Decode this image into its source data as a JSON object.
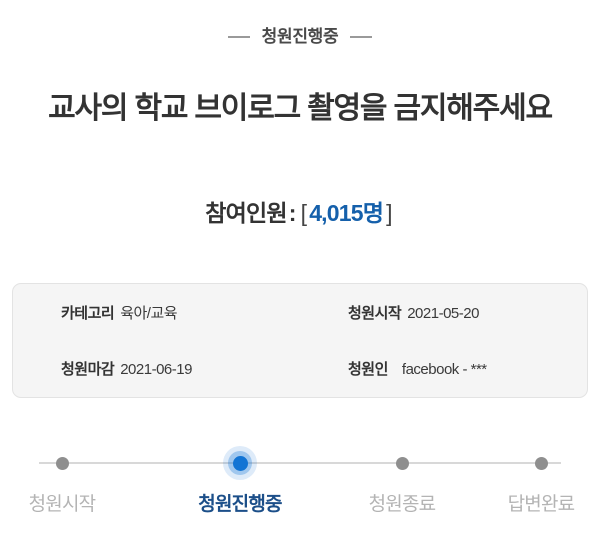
{
  "header": {
    "status_eyebrow": "청원진행중",
    "title": "교사의 학교 브이로그 촬영을 금지해주세요"
  },
  "participants": {
    "label": "참여인원",
    "colon": ":",
    "bracket_open": "[",
    "count": "4,015명",
    "bracket_close": "]",
    "count_color": "#1560ab"
  },
  "info_card": {
    "rows": [
      {
        "label": "카테고리",
        "value": "육아/교육"
      },
      {
        "label": "청원시작",
        "value": "2021-05-20"
      },
      {
        "label": "청원마감",
        "value": "2021-06-19"
      },
      {
        "label": "청원인",
        "value": "facebook - ***"
      }
    ]
  },
  "stepper": {
    "active_index": 1,
    "active_color": "#1274d4",
    "active_label_color": "#1c4f89",
    "inactive_color": "#8f8f8f",
    "steps": [
      {
        "label": "청원시작",
        "state": "inactive"
      },
      {
        "label": "청원진행중",
        "state": "active"
      },
      {
        "label": "청원종료",
        "state": "inactive"
      },
      {
        "label": "답변완료",
        "state": "inactive"
      }
    ]
  }
}
